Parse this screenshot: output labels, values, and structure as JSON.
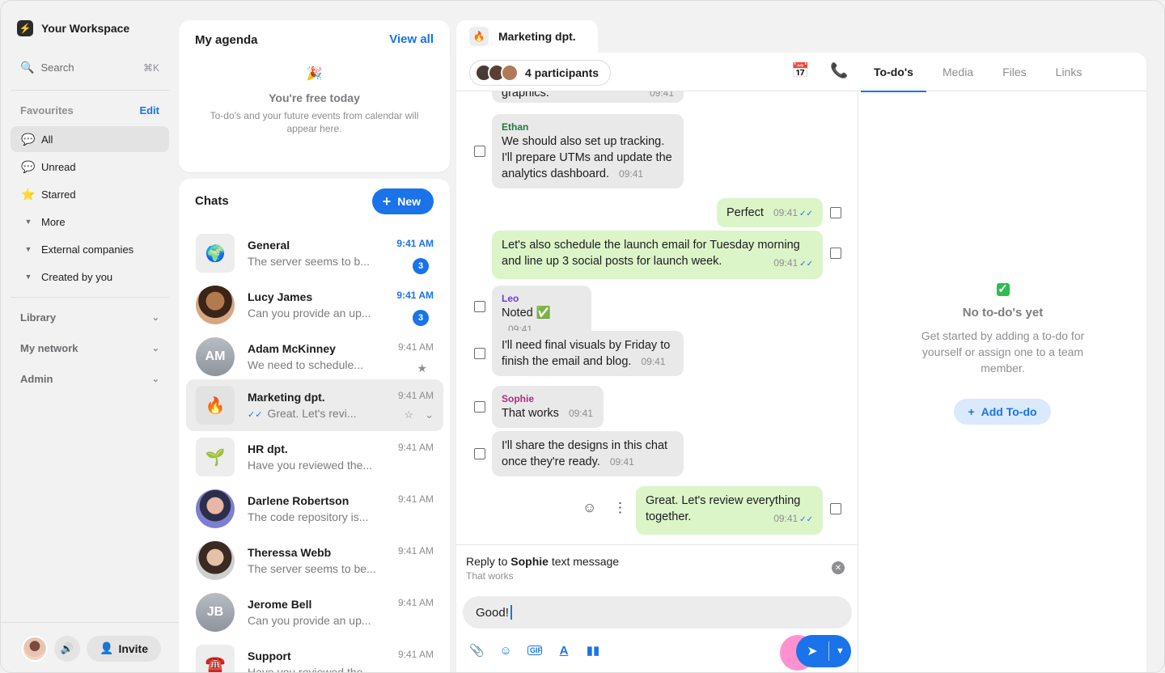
{
  "workspace": {
    "name": "Your Workspace",
    "logo_icon": "bolt-icon"
  },
  "search": {
    "label": "Search",
    "shortcut": "⌘K"
  },
  "favourites": {
    "header": "Favourites",
    "edit": "Edit",
    "items": [
      {
        "label": "All",
        "icon": "chat-bubble-icon",
        "active": true
      },
      {
        "label": "Unread",
        "icon": "chat-bubble-dot-icon"
      },
      {
        "label": "Starred",
        "icon": "star-icon"
      },
      {
        "label": "More",
        "icon": "caret-down-icon"
      },
      {
        "label": "External companies",
        "icon": "caret-down-icon"
      },
      {
        "label": "Created by you",
        "icon": "caret-down-icon"
      }
    ]
  },
  "sections": [
    "Library",
    "My network",
    "Admin"
  ],
  "sidebar_bottom": {
    "invite": "Invite"
  },
  "agenda": {
    "title": "My agenda",
    "view_all": "View all",
    "empty_title": "You're free today",
    "empty_text": "To-do's and your future events from calendar will appear here."
  },
  "chats": {
    "title": "Chats",
    "new_label": "New",
    "items": [
      {
        "name": "General",
        "preview": "The server seems to b...",
        "time": "9:41 AM",
        "unread": "3"
      },
      {
        "name": "Lucy James",
        "preview": "Can you provide an up...",
        "time": "9:41 AM",
        "unread": "3"
      },
      {
        "name": "Adam McKinney",
        "initials": "AM",
        "preview": "We need to schedule...",
        "time": "9:41 AM"
      },
      {
        "name": "Marketing dpt.",
        "preview": "Great. Let's revi...",
        "time": "9:41 AM"
      },
      {
        "name": "HR dpt.",
        "preview": "Have you reviewed the...",
        "time": "9:41 AM"
      },
      {
        "name": "Darlene Robertson",
        "preview": "The code repository is...",
        "time": "9:41 AM"
      },
      {
        "name": "Theressa Webb",
        "preview": "The server seems to be...",
        "time": "9:41 AM"
      },
      {
        "name": "Jerome Bell",
        "initials": "JB",
        "preview": "Can you provide an up...",
        "time": "9:41 AM"
      },
      {
        "name": "Support",
        "preview": "Have you reviewed the...",
        "time": "9:41 AM"
      }
    ]
  },
  "conversation": {
    "title": "Marketing dpt.",
    "participants": "4 participants",
    "messages": [
      {
        "text": "graphics.",
        "time": "09:41"
      },
      {
        "sender": "Ethan",
        "text": "We should also set up tracking. I'll prepare UTMs and update the analytics dashboard.",
        "time": "09:41"
      },
      {
        "text": "Perfect",
        "time": "09:41"
      },
      {
        "text": "Let's also schedule the launch email for Tuesday morning and line up 3 social posts for launch week.",
        "time": "09:41"
      },
      {
        "sender": "Leo",
        "text": "Noted ✅",
        "time": "09:41"
      },
      {
        "text": "I'll need final visuals by Friday to finish the email and blog.",
        "time": "09:41"
      },
      {
        "sender": "Sophie",
        "text": "That works",
        "time": "09:41"
      },
      {
        "text": "I'll share the designs in this chat once they're ready.",
        "time": "09:41"
      },
      {
        "text": "Great. Let's review everything together.",
        "time": "09:41"
      }
    ],
    "reply": {
      "prefix": "Reply to",
      "name": "Sophie",
      "suffix": "text message",
      "quote": "That works"
    },
    "composer_value": "Good!"
  },
  "right_panel": {
    "tabs": [
      "To-do's",
      "Media",
      "Files",
      "Links"
    ],
    "empty_title": "No to-do's yet",
    "empty_text": "Get started by adding a to-do for yourself or assign one to a team member.",
    "add_label": "Add To-do"
  },
  "colors": {
    "accent": "#1a73e8",
    "outgoing_bubble": "#dbf5c9",
    "incoming_bubble": "#e9e9ea"
  }
}
